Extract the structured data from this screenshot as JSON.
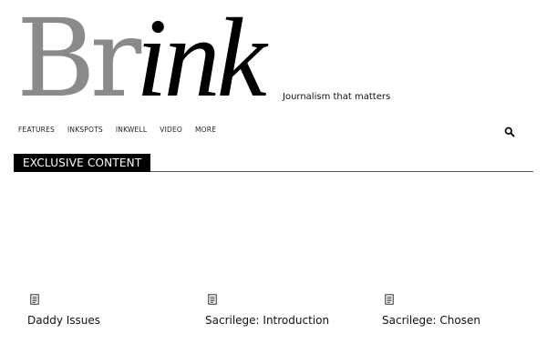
{
  "site": {
    "logo_part1": "Br",
    "logo_part2": "ink",
    "tagline": "Journalism that matters"
  },
  "nav": {
    "items": [
      {
        "label": "FEATURES"
      },
      {
        "label": "INKSPOTS"
      },
      {
        "label": "INKWELL"
      },
      {
        "label": "VIDEO"
      },
      {
        "label": "MORE"
      }
    ],
    "search_icon": "search-icon"
  },
  "section": {
    "title": "EXCLUSIVE CONTENT"
  },
  "articles": [
    {
      "icon": "document-icon",
      "title": "Daddy Issues"
    },
    {
      "icon": "document-icon",
      "title": "Sacrilege: Introduction"
    },
    {
      "icon": "document-icon",
      "title": "Sacrilege: Chosen"
    }
  ],
  "colors": {
    "logo_gray": "#8a8a8a",
    "logo_black": "#000000",
    "section_bg": "#000000",
    "section_text": "#ffffff"
  }
}
